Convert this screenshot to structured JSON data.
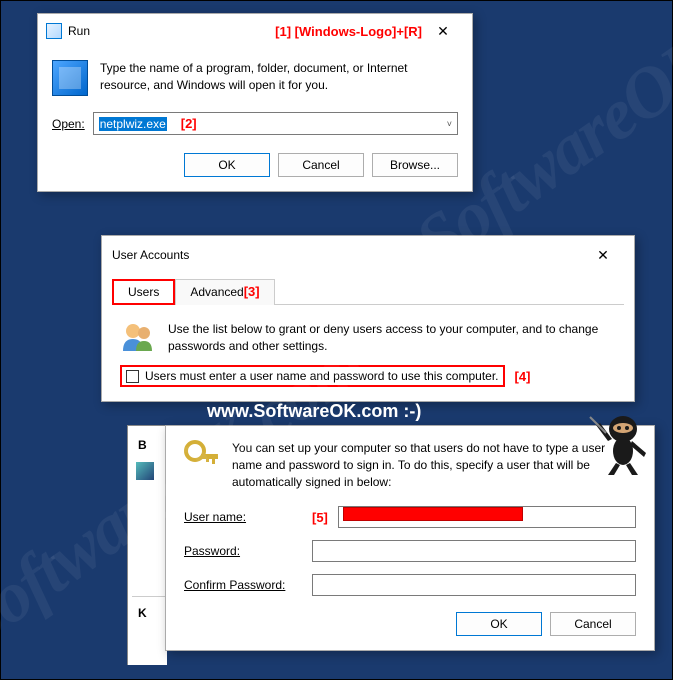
{
  "run_dialog": {
    "title": "Run",
    "annotation_1": "[1]  [Windows-Logo]+[R]",
    "description": "Type the name of a program, folder, document, or Internet resource, and Windows will open it for you.",
    "open_label": "Open:",
    "open_value": "netplwiz.exe",
    "annotation_2": "[2]",
    "buttons": {
      "ok": "OK",
      "cancel": "Cancel",
      "browse": "Browse..."
    }
  },
  "user_accounts": {
    "title": "User Accounts",
    "tabs": {
      "users": "Users",
      "advanced": "Advanced"
    },
    "annotation_3": "[3]",
    "info_text": "Use the list below to grant or deny users access to your computer, and to change passwords and other settings.",
    "checkbox_label": "Users must enter a user name and password to use this computer.",
    "annotation_4": "[4]"
  },
  "watermark_center": "www.SoftwareOK.com :-)",
  "watermark_diag": "SoftwareOK.com",
  "auto_signin": {
    "description": "You can set up your computer so that users do not have to type a user name and password to sign in. To do this, specify a user that will be automatically signed in below:",
    "username_label": "User name:",
    "annotation_5": "[5]",
    "password_label": "Password:",
    "confirm_label": "Confirm Password:",
    "buttons": {
      "ok": "OK",
      "cancel": "Cancel"
    }
  },
  "partial": {
    "stub1": "B",
    "stub2": "K"
  }
}
